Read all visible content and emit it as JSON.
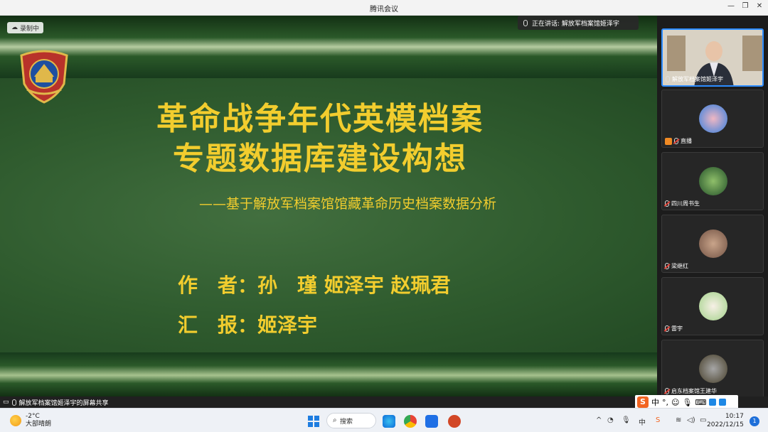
{
  "window": {
    "title": "腾讯会议"
  },
  "recording": {
    "label": "录制中"
  },
  "speaking": {
    "text": "正在讲话: 解放军档案馆姬泽宇"
  },
  "slide": {
    "title_line1": "革命战争年代英模档案",
    "title_line2": "专题数据库建设构想",
    "subtitle": "——基于解放军档案馆馆藏革命历史档案数据分析",
    "author": "作　者：孙　瑾 姬泽宇 赵珮君",
    "reporter": "汇　报：姬泽宇"
  },
  "participants": [
    {
      "name": "解放军档案馆姬泽宇",
      "video": true
    },
    {
      "name": "直播"
    },
    {
      "name": "四川周书生"
    },
    {
      "name": "梁继红"
    },
    {
      "name": "雷宇"
    },
    {
      "name": "启东档案馆王建华"
    }
  ],
  "share_bar": {
    "text": "解放军档案馆姬泽宇的屏幕共享"
  },
  "ime": {
    "mode": "中"
  },
  "taskbar": {
    "weather_temp": "-2°C",
    "weather_desc": "大部晴朗",
    "search_label": "搜索",
    "ime_char": "中",
    "time": "10:17",
    "date": "2022/12/15",
    "notifications": "1"
  },
  "colors": {
    "slide_text": "#f2cd2e",
    "slide_bg": "#2f5b2e",
    "accent": "#2c8cff"
  }
}
